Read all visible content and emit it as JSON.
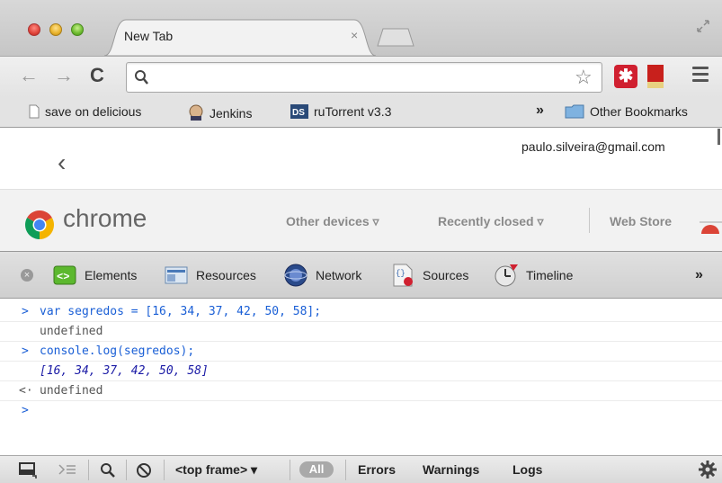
{
  "browser": {
    "tab": {
      "title": "New Tab",
      "close_glyph": "×"
    },
    "toolbar": {
      "back_glyph": "←",
      "forward_glyph": "→",
      "reload_glyph": "C",
      "omnibox_value": "",
      "star_glyph": "☆",
      "extension_glyph": "✱"
    },
    "bookmarks": [
      {
        "label": "save on delicious",
        "icon": "page-icon"
      },
      {
        "label": "Jenkins",
        "icon": "jenkins-icon"
      },
      {
        "label": "ruTorrent v3.3",
        "icon": "rutorrent-icon"
      }
    ],
    "bookmarks_overflow": "»",
    "other_bookmarks": "Other Bookmarks"
  },
  "ntp": {
    "user_email": "paulo.silveira@gmail.com",
    "back_glyph": "‹",
    "brand": "chrome",
    "links": {
      "other_devices": "Other devices ▿",
      "recently_closed": "Recently closed ▿",
      "web_store": "Web Store"
    }
  },
  "devtools": {
    "tabs": [
      {
        "label": "Elements"
      },
      {
        "label": "Resources"
      },
      {
        "label": "Network"
      },
      {
        "label": "Sources"
      },
      {
        "label": "Timeline"
      }
    ],
    "overflow": "»",
    "console": {
      "lines": [
        {
          "prompt": ">",
          "text": "var segredos = [16, 34, 37, 42, 50, 58];",
          "kind": "command"
        },
        {
          "prompt": "",
          "text": "undefined",
          "kind": "output"
        },
        {
          "prompt": ">",
          "text": "console.log(segredos);",
          "kind": "command"
        },
        {
          "prompt": "",
          "text": "[16, 34, 37, 42, 50, 58]",
          "kind": "log"
        },
        {
          "prompt": "<·",
          "text": "undefined",
          "kind": "return"
        },
        {
          "prompt": ">",
          "text": "",
          "kind": "input"
        }
      ]
    },
    "statusbar": {
      "frame": "<top frame> ▾",
      "filter_all": "All",
      "filter_errors": "Errors",
      "filter_warnings": "Warnings",
      "filter_logs": "Logs"
    }
  },
  "colors": {
    "console_command": "#1a5fd6",
    "console_log": "#1b1ba6",
    "console_output": "#555555"
  }
}
